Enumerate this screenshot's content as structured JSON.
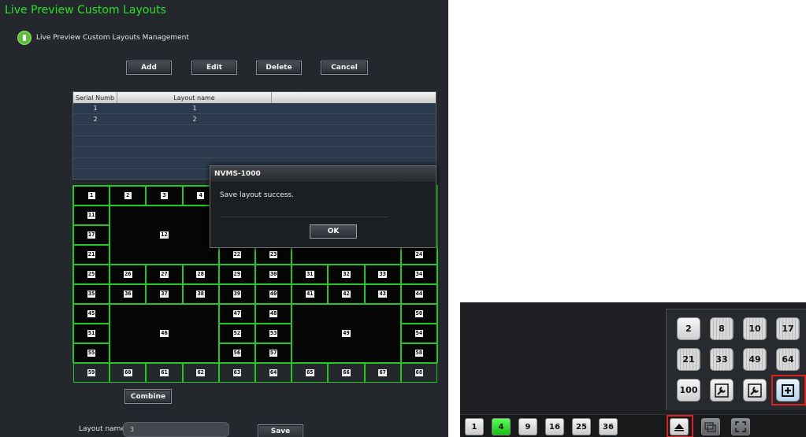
{
  "left_panel": {
    "title": "Live Preview Custom Layouts",
    "subtitle": "Live Preview Custom Layouts Management",
    "buttons": {
      "add": "Add",
      "edit": "Edit",
      "delete": "Delete",
      "cancel": "Cancel"
    },
    "table": {
      "headers": [
        "Serial Numb",
        "Layout name"
      ],
      "rows": [
        [
          "1",
          "1"
        ],
        [
          "2",
          "2"
        ]
      ]
    },
    "grid_numbers": [
      "1",
      "2",
      "3",
      "4",
      "11",
      "12",
      "17",
      "21",
      "22",
      "23",
      "24",
      "25",
      "26",
      "27",
      "28",
      "29",
      "30",
      "31",
      "32",
      "33",
      "34",
      "35",
      "36",
      "37",
      "38",
      "39",
      "40",
      "41",
      "42",
      "43",
      "44",
      "45",
      "46",
      "47",
      "48",
      "49",
      "50",
      "51",
      "52",
      "53",
      "54",
      "55",
      "56",
      "57",
      "58",
      "59",
      "60",
      "61",
      "62",
      "63",
      "64",
      "65",
      "66",
      "67",
      "68"
    ],
    "combine_label": "Combine",
    "layout_name_label": "Layout name",
    "layout_name_value": "3",
    "save_label": "Save"
  },
  "dialog": {
    "title": "NVMS-1000",
    "message": "Save layout success.",
    "ok_label": "OK"
  },
  "layout_popup": {
    "row1": [
      "2",
      "8",
      "10",
      "17"
    ],
    "row2": [
      "21",
      "33",
      "49",
      "64"
    ],
    "row3": [
      "100",
      "wrench-icon",
      "wrench-icon",
      "custom-layout-icon"
    ]
  },
  "layout_toolbar": {
    "buttons": [
      "1",
      "4",
      "9",
      "16",
      "25",
      "36"
    ],
    "active": "4"
  },
  "colors": {
    "accent_green": "#27e227",
    "grid_green": "#23c623",
    "highlight_red": "#e02020"
  }
}
